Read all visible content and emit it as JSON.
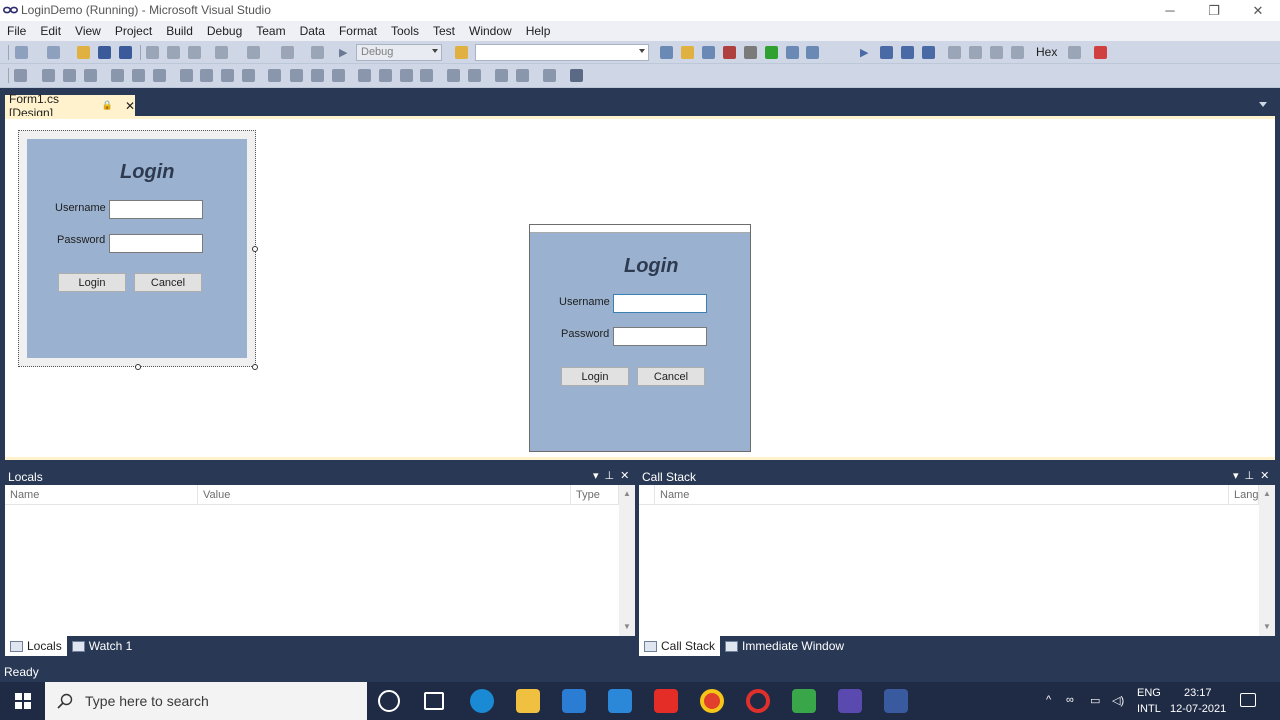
{
  "window": {
    "title": "LoginDemo (Running) - Microsoft Visual Studio",
    "controls": {
      "minimize": "─",
      "restore": "❐",
      "close": "✕"
    }
  },
  "menu": [
    "File",
    "Edit",
    "View",
    "Project",
    "Build",
    "Debug",
    "Team",
    "Data",
    "Format",
    "Tools",
    "Test",
    "Window",
    "Help"
  ],
  "toolbar": {
    "config_dropdown": "Debug",
    "platform_dropdown": "",
    "hex_label": "Hex"
  },
  "doc_tab": {
    "label": "Form1.cs [Design]",
    "lock_glyph": "🔒",
    "close_glyph": "✕"
  },
  "design_form": {
    "title": "Login",
    "username_label": "Username",
    "password_label": "Password",
    "login_button": "Login",
    "cancel_button": "Cancel"
  },
  "running_form": {
    "title": "Login",
    "username_label": "Username",
    "password_label": "Password",
    "username_value": "",
    "password_value": "",
    "login_button": "Login",
    "cancel_button": "Cancel"
  },
  "locals_panel": {
    "title": "Locals",
    "columns": [
      "Name",
      "Value",
      "Type"
    ],
    "tabs": [
      "Locals",
      "Watch 1"
    ]
  },
  "callstack_panel": {
    "title": "Call Stack",
    "columns": [
      "Name",
      "Lang"
    ],
    "tabs": [
      "Call Stack",
      "Immediate Window"
    ]
  },
  "status": {
    "text": "Ready"
  },
  "taskbar": {
    "search_placeholder": "Type here to search",
    "language": "ENG",
    "layout": "INTL",
    "time": "23:17",
    "date": "12-07-2021"
  },
  "colors": {
    "vs_dark": "#293955",
    "form_bg": "#9ab2d0",
    "tab_active": "#fff2cc"
  }
}
